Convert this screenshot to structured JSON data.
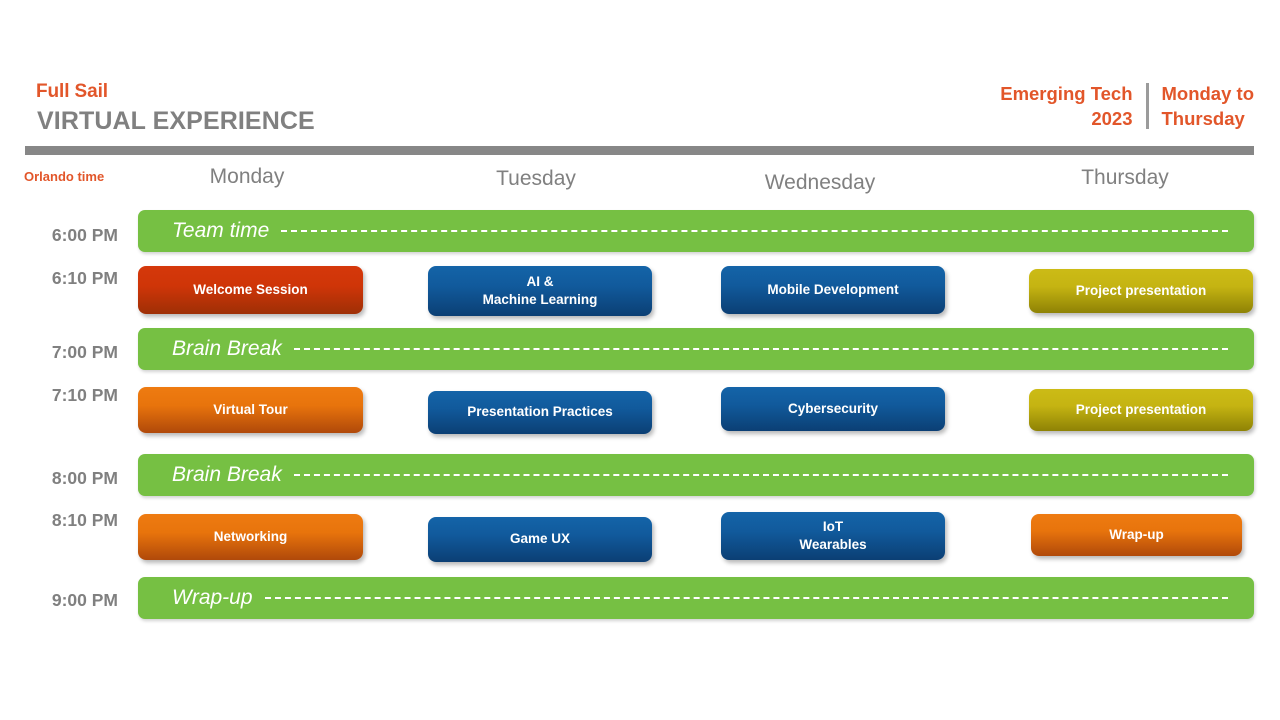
{
  "header": {
    "brand_name": "Full Sail",
    "brand_subtitle": "VIRTUAL EXPERIENCE",
    "event_title_line1": "Emerging Tech",
    "event_title_line2": "2023",
    "event_dates_line1": "Monday to",
    "event_dates_line2": "Thursday",
    "accent_color": "#e2562a",
    "rule_color": "#878787"
  },
  "columns": {
    "time_label": "Orlando time",
    "days": [
      "Monday",
      "Tuesday",
      "Wednesday",
      "Thursday"
    ]
  },
  "times": [
    "6:00 PM",
    "6:10 PM",
    "7:00 PM",
    "7:10 PM",
    "8:00 PM",
    "8:10 PM",
    "9:00 PM"
  ],
  "break_bars": [
    {
      "time": "6:00 PM",
      "label": "Team time",
      "color": "#76c043"
    },
    {
      "time": "7:00 PM",
      "label": "Brain Break",
      "color": "#76c043"
    },
    {
      "time": "8:00 PM",
      "label": "Brain Break",
      "color": "#76c043"
    },
    {
      "time": "9:00 PM",
      "label": "Wrap-up",
      "color": "#76c043"
    }
  ],
  "sessions": [
    {
      "time": "6:10 PM",
      "day": "Monday",
      "label": "Welcome Session",
      "color": "#cf3508"
    },
    {
      "time": "6:10 PM",
      "day": "Tuesday",
      "label": "AI &\nMachine Learning",
      "color": "#115a9c"
    },
    {
      "time": "6:10 PM",
      "day": "Wednesday",
      "label": "Mobile Development",
      "color": "#115a9c"
    },
    {
      "time": "6:10 PM",
      "day": "Thursday",
      "label": "Project presentation",
      "color": "#c5b412"
    },
    {
      "time": "7:10 PM",
      "day": "Monday",
      "label": "Virtual Tour",
      "color": "#e8740c"
    },
    {
      "time": "7:10 PM",
      "day": "Tuesday",
      "label": "Presentation Practices",
      "color": "#115a9c"
    },
    {
      "time": "7:10 PM",
      "day": "Wednesday",
      "label": "Cybersecurity",
      "color": "#115a9c"
    },
    {
      "time": "7:10 PM",
      "day": "Thursday",
      "label": "Project presentation",
      "color": "#c5b412"
    },
    {
      "time": "8:10 PM",
      "day": "Monday",
      "label": "Networking",
      "color": "#e8740c"
    },
    {
      "time": "8:10 PM",
      "day": "Tuesday",
      "label": "Game UX",
      "color": "#115a9c"
    },
    {
      "time": "8:10 PM",
      "day": "Wednesday",
      "label": "IoT\nWearables",
      "color": "#115a9c"
    },
    {
      "time": "8:10 PM",
      "day": "Thursday",
      "label": "Wrap-up",
      "color": "#e8740c"
    }
  ]
}
